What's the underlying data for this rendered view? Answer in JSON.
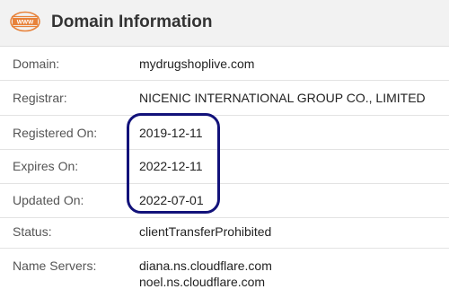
{
  "header": {
    "icon_name": "globe-www-icon",
    "icon_text": "WWW",
    "icon_color": "#e8823a",
    "title": "Domain Information"
  },
  "rows": [
    {
      "label": "Domain:",
      "value": "mydrugshoplive.com"
    },
    {
      "label": "Registrar:",
      "value": "NICENIC INTERNATIONAL GROUP CO., LIMITED"
    },
    {
      "label": "Registered On:",
      "value": "2019-12-11"
    },
    {
      "label": "Expires On:",
      "value": "2022-12-11"
    },
    {
      "label": "Updated On:",
      "value": "2022-07-01"
    },
    {
      "label": "Status:",
      "value": "clientTransferProhibited"
    },
    {
      "label": "Name Servers:",
      "values": [
        "diana.ns.cloudflare.com",
        "noel.ns.cloudflare.com"
      ]
    }
  ],
  "annotation": {
    "highlight_color": "#12127a"
  }
}
